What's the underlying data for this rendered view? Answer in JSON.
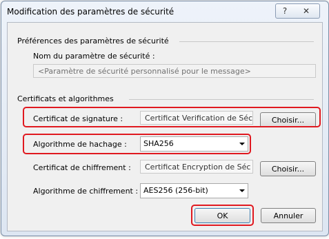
{
  "window": {
    "title": "Modification des paramètres de sécurité",
    "help_symbol": "?",
    "close_symbol": "✕"
  },
  "security_prefs": {
    "group_label": "Préférences des paramètres de sécurité",
    "name_label": "Nom du paramètre de sécurité :",
    "name_value": "<Paramètre de sécurité personnalisé pour le message>"
  },
  "certs": {
    "group_label": "Certificats et algorithmes",
    "signing_cert_label": "Certificat de signature :",
    "signing_cert_value": "Certificat Verification de Séc",
    "signing_choose": "Choisir...",
    "hash_label": "Algorithme de hachage :",
    "hash_value": "SHA256",
    "enc_cert_label": "Certificat de chiffrement :",
    "enc_cert_value": "Certificat Encryption de Séc",
    "enc_choose": "Choisir...",
    "enc_alg_label": "Algorithme de chiffrement :",
    "enc_alg_value": "AES256 (256-bit)"
  },
  "buttons": {
    "ok": "OK",
    "cancel": "Annuler"
  },
  "colors": {
    "highlight": "#e0181f"
  }
}
